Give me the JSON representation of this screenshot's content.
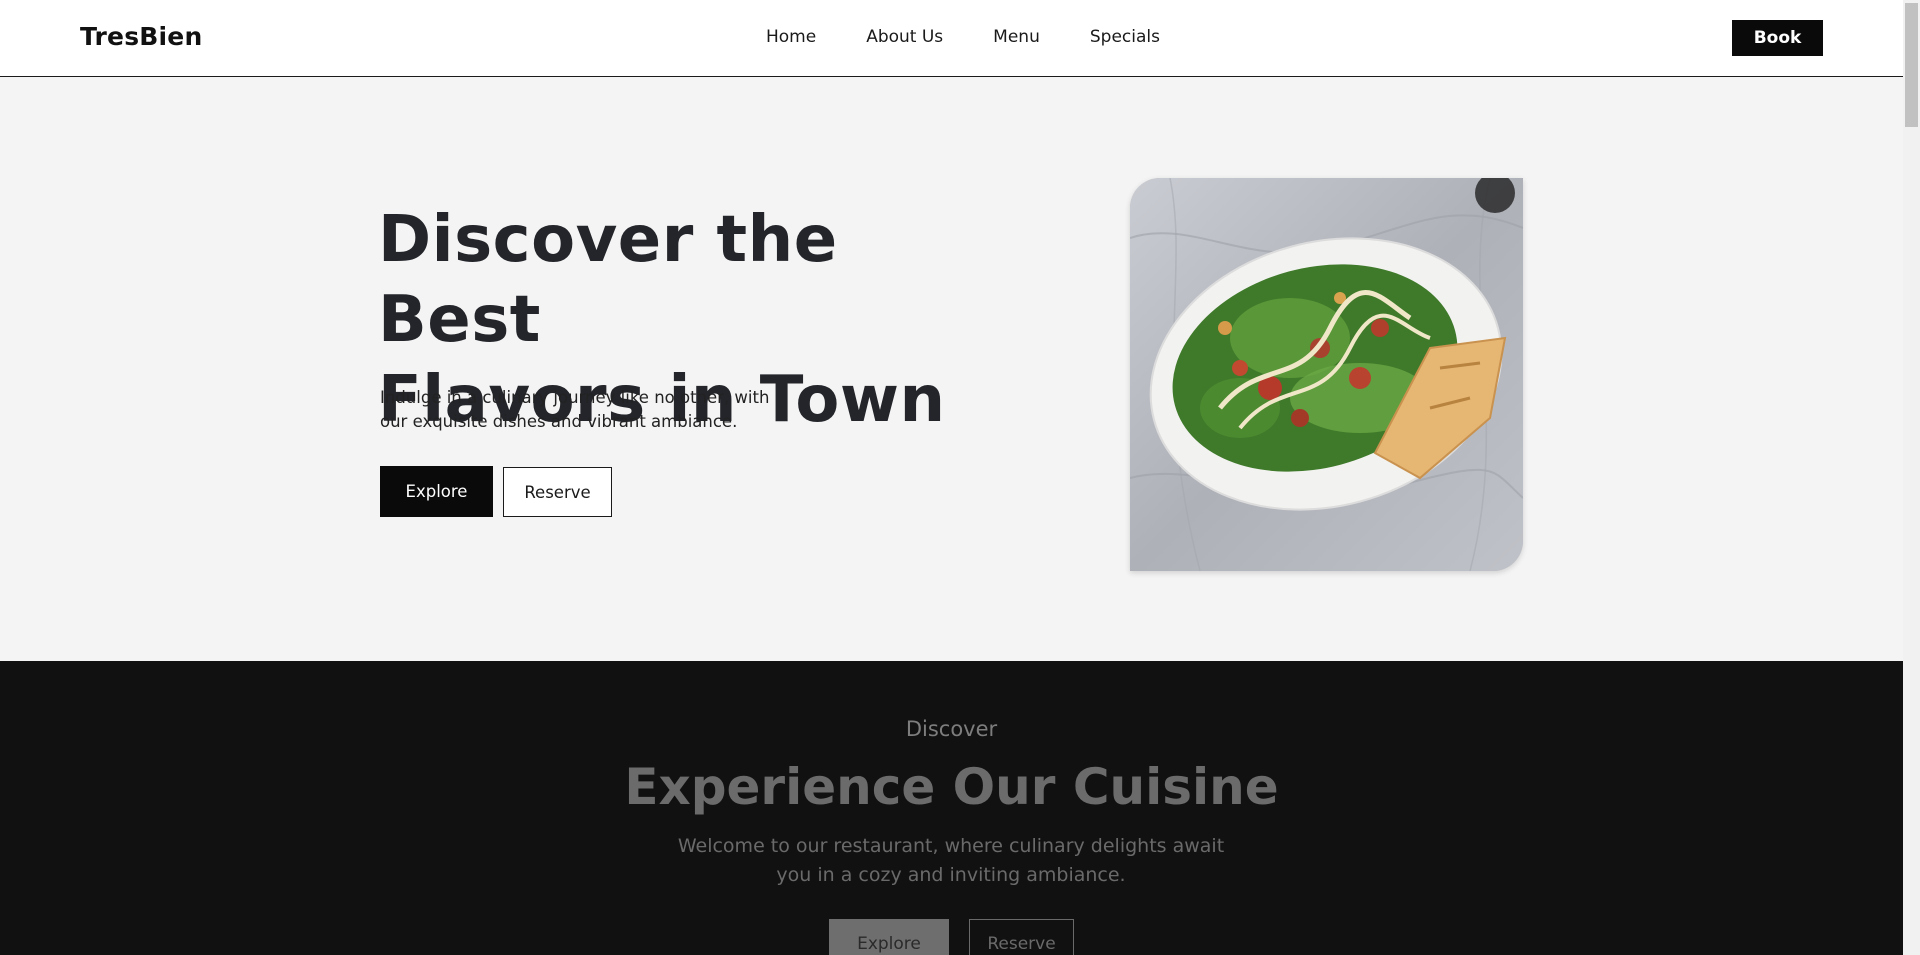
{
  "header": {
    "logo": "TresBien",
    "nav": [
      "Home",
      "About Us",
      "Menu",
      "Specials"
    ],
    "book_label": "Book"
  },
  "hero": {
    "title_line1": "Discover the Best",
    "title_line2": "Flavors in Town",
    "text_line1": "Indulge in a culinary journey like no other, with",
    "text_line2": "our exquisite dishes and vibrant ambiance.",
    "explore_label": "Explore",
    "reserve_label": "Reserve",
    "image_icon": "caesar-salad-plate"
  },
  "section": {
    "kicker": "Discover",
    "title": "Experience Our Cuisine",
    "text_line1": "Welcome to our restaurant, where culinary delights await",
    "text_line2": "you in a cozy and inviting ambiance.",
    "explore_label": "Explore",
    "reserve_label": "Reserve"
  },
  "colors": {
    "brand_dark": "#0a0a0a",
    "hero_bg": "#f4f4f4",
    "section_bg": "#111111"
  }
}
